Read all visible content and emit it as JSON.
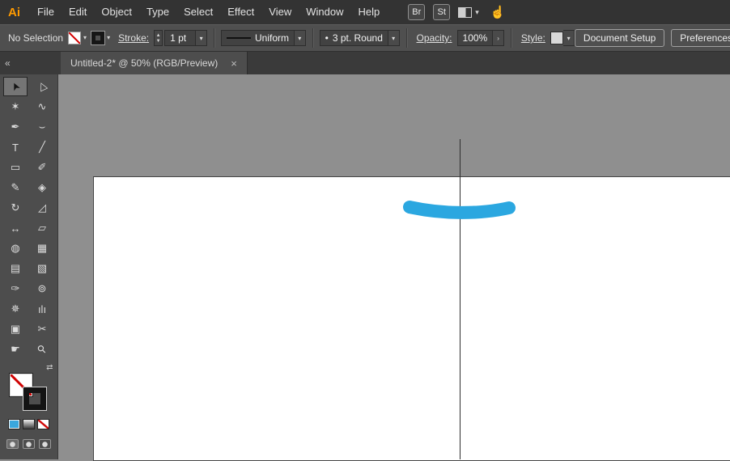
{
  "app_bar": {
    "logo": "Ai",
    "menus": [
      {
        "name": "file",
        "label": "File"
      },
      {
        "name": "edit",
        "label": "Edit"
      },
      {
        "name": "object",
        "label": "Object"
      },
      {
        "name": "type",
        "label": "Type"
      },
      {
        "name": "select",
        "label": "Select"
      },
      {
        "name": "effect",
        "label": "Effect"
      },
      {
        "name": "view",
        "label": "View"
      },
      {
        "name": "window",
        "label": "Window"
      },
      {
        "name": "help",
        "label": "Help"
      }
    ],
    "bridge_badge": "Br",
    "stock_badge": "St"
  },
  "control_bar": {
    "selection_status": "No Selection",
    "stroke_label": "Stroke:",
    "stroke_value": "1 pt",
    "width_profile_value": "Uniform",
    "brush_preview_glyph": "•",
    "brush_value": "3 pt. Round",
    "opacity_label": "Opacity:",
    "opacity_value": "100%",
    "style_label": "Style:",
    "document_setup_label": "Document Setup",
    "preferences_label": "Preferences"
  },
  "document_tab": {
    "title": "Untitled-2* @ 50% (RGB/Preview)"
  },
  "toolbar": {
    "collapse_glyph": "«",
    "swap_glyph": "⇄",
    "tools": [
      {
        "name": "selection",
        "glyph": "➤",
        "active": true
      },
      {
        "name": "direct-selection",
        "glyph": "▷",
        "active": false
      },
      {
        "name": "magic-wand",
        "glyph": "✶",
        "active": false
      },
      {
        "name": "lasso",
        "glyph": "∿",
        "active": false
      },
      {
        "name": "pen",
        "glyph": "✒",
        "active": false
      },
      {
        "name": "curvature",
        "glyph": "⌣",
        "active": false
      },
      {
        "name": "type",
        "glyph": "T",
        "active": false
      },
      {
        "name": "line-segment",
        "glyph": "╱",
        "active": false
      },
      {
        "name": "rectangle",
        "glyph": "▭",
        "active": false
      },
      {
        "name": "paintbrush",
        "glyph": "✐",
        "active": false
      },
      {
        "name": "shaper",
        "glyph": "✎",
        "active": false
      },
      {
        "name": "eraser",
        "glyph": "◈",
        "active": false
      },
      {
        "name": "rotate",
        "glyph": "↻",
        "active": false
      },
      {
        "name": "scale",
        "glyph": "◿",
        "active": false
      },
      {
        "name": "width",
        "glyph": "↔",
        "active": false
      },
      {
        "name": "free-transform",
        "glyph": "▱",
        "active": false
      },
      {
        "name": "shape-builder",
        "glyph": "◍",
        "active": false
      },
      {
        "name": "perspective-grid",
        "glyph": "▦",
        "active": false
      },
      {
        "name": "mesh",
        "glyph": "▤",
        "active": false
      },
      {
        "name": "gradient",
        "glyph": "▧",
        "active": false
      },
      {
        "name": "eyedropper",
        "glyph": "✑",
        "active": false
      },
      {
        "name": "blend",
        "glyph": "⊚",
        "active": false
      },
      {
        "name": "symbol-sprayer",
        "glyph": "✵",
        "active": false
      },
      {
        "name": "column-graph",
        "glyph": "ılı",
        "active": false
      },
      {
        "name": "artboard",
        "glyph": "▣",
        "active": false
      },
      {
        "name": "slice",
        "glyph": "✂",
        "active": false
      },
      {
        "name": "hand",
        "glyph": "☛",
        "active": false
      },
      {
        "name": "zoom",
        "glyph": "⚲",
        "active": false
      }
    ]
  },
  "glyphs": {
    "chevron_down": "▾",
    "chevron_right": "›",
    "stepper_up": "▲",
    "stepper_down": "▼",
    "close": "×",
    "hand": "☝"
  },
  "colors": {
    "logo_orange": "#ff9a00",
    "brush_blue": "#2BA7E0",
    "none_red": "#d40000",
    "path_gray": "#2f2f2f",
    "canvas_gray": "#8f8f8f",
    "artboard_white": "#ffffff"
  }
}
